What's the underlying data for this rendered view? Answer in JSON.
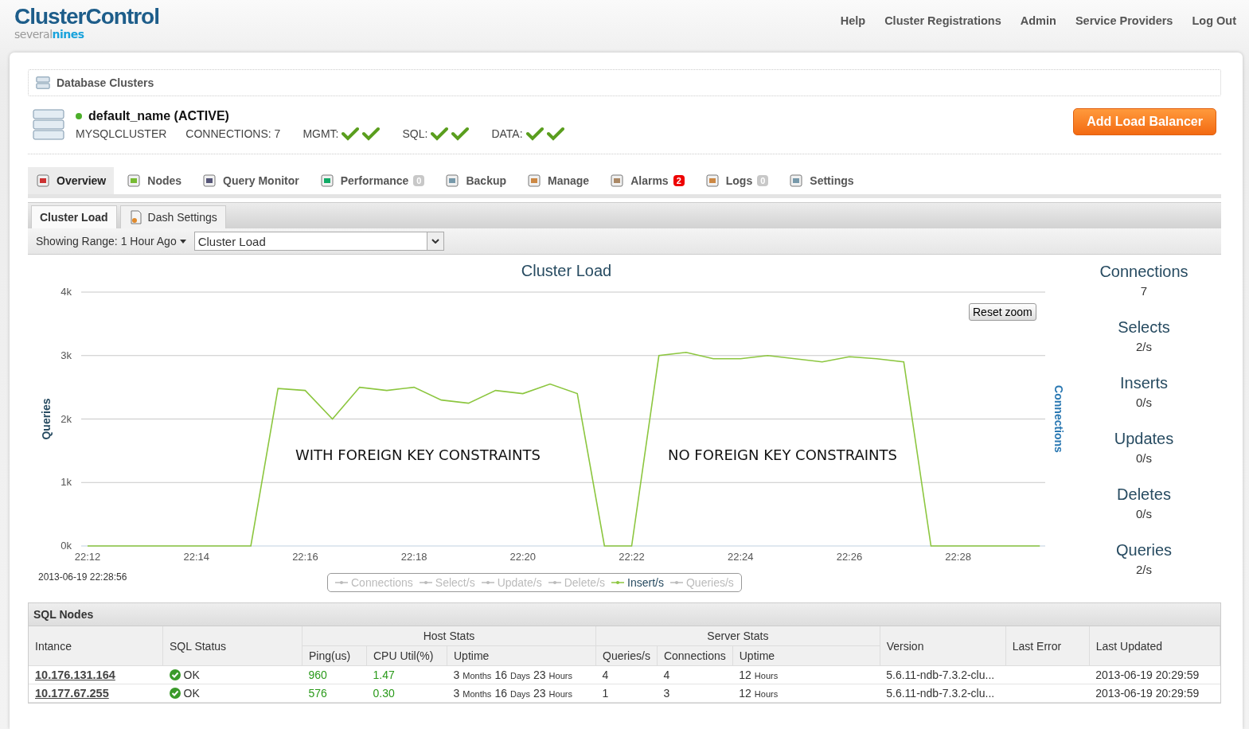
{
  "header": {
    "logo_main": "ClusterControl",
    "logo_sub_a": "several",
    "logo_sub_b": "nines",
    "nav": [
      "Help",
      "Cluster Registrations",
      "Admin",
      "Service Providers",
      "Log Out"
    ]
  },
  "breadcrumb": "Database Clusters",
  "cluster": {
    "name": "default_name (ACTIVE)",
    "active": true,
    "type": "MYSQLCLUSTER",
    "connections": "CONNECTIONS: 7",
    "groups": [
      {
        "label": "MGMT:",
        "checks": [
          {
            "ok": true
          },
          {
            "ok": true
          }
        ]
      },
      {
        "label": "SQL:",
        "checks": [
          {
            "ok": true
          },
          {
            "ok": true
          }
        ]
      },
      {
        "label": "DATA:",
        "checks": [
          {
            "ok": true
          },
          {
            "ok": true
          }
        ]
      }
    ],
    "action": "Add Load Balancer"
  },
  "tabs": [
    {
      "label": "Overview",
      "selected": true
    },
    {
      "label": "Nodes",
      "selected": false
    },
    {
      "label": "Query Monitor",
      "selected": false
    },
    {
      "label": "Performance",
      "selected": false,
      "badge": "0",
      "alert": false
    },
    {
      "label": "Backup",
      "selected": false
    },
    {
      "label": "Manage",
      "selected": false
    },
    {
      "label": "Alarms",
      "selected": false,
      "badge": "2",
      "alert": true
    },
    {
      "label": "Logs",
      "selected": false,
      "badge": "0",
      "alert": false
    },
    {
      "label": "Settings",
      "selected": false
    }
  ],
  "subtabs": [
    {
      "label": "Cluster Load",
      "selected": true
    },
    {
      "label": "Dash Settings",
      "selected": false
    }
  ],
  "range": {
    "label": "Showing Range: 1 Hour Ago",
    "select": "Cluster Load"
  },
  "chart": {
    "reset": "Reset zoom",
    "timestamp": "2013-06-19 22:28:56",
    "right_label": "Connections",
    "legend": [
      {
        "kind": "hidden",
        "label": "Connections"
      },
      {
        "kind": "hidden",
        "label": "Select/s"
      },
      {
        "kind": "hidden",
        "label": "Update/s"
      },
      {
        "kind": "hidden",
        "label": "Delete/s"
      },
      {
        "kind": "series"
      },
      {
        "kind": "hidden",
        "label": "Queries/s"
      }
    ],
    "chart_data": {
      "type": "line",
      "title": "Cluster Load",
      "ylabel": "Queries",
      "categories": [
        "22:12",
        null,
        null,
        null,
        "22:14",
        null,
        null,
        null,
        "22:16",
        null,
        null,
        null,
        "22:18",
        null,
        null,
        null,
        "22:20",
        null,
        null,
        null,
        "22:22",
        null,
        null,
        null,
        "22:24",
        null,
        null,
        null,
        "22:26",
        null,
        null,
        null,
        "22:28",
        null,
        null,
        null
      ],
      "series": [
        {
          "name": "Insert/s",
          "color": "#8cc63f",
          "values": [
            0,
            0,
            0,
            0,
            0,
            0,
            0,
            2480,
            2450,
            2000,
            2500,
            2450,
            2500,
            2300,
            2250,
            2450,
            2400,
            2550,
            2400,
            0,
            0,
            3000,
            3050,
            2950,
            2950,
            3000,
            2950,
            2900,
            2980,
            2950,
            2900,
            0,
            0,
            0,
            0,
            0
          ]
        }
      ],
      "ylim": [
        0,
        4000
      ],
      "grid": true,
      "yticks": [
        {
          "value": 0,
          "label": "0k"
        },
        {
          "value": 1000,
          "label": "1k"
        },
        {
          "value": 2000,
          "label": "2k"
        },
        {
          "value": 3000,
          "label": "3k"
        },
        {
          "value": 4000,
          "label": "4k"
        }
      ],
      "annotations": [
        "WITH FOREIGN KEY CONSTRAINTS",
        "NO FOREIGN KEY CONSTRAINTS"
      ]
    }
  },
  "stats": [
    {
      "label": "Connections",
      "value": "7"
    },
    {
      "label": "Selects",
      "value": "2/s"
    },
    {
      "label": "Inserts",
      "value": "0/s"
    },
    {
      "label": "Updates",
      "value": "0/s"
    },
    {
      "label": "Deletes",
      "value": "0/s"
    },
    {
      "label": "Queries",
      "value": "2/s"
    }
  ],
  "sql_nodes": {
    "title": "SQL Nodes",
    "group_host": "Host Stats",
    "group_server": "Server Stats",
    "columns": [
      "Intance",
      "SQL Status",
      "Ping(us)",
      "CPU Util(%)",
      "Uptime",
      "Queries/s",
      "Connections",
      "Uptime",
      "Version",
      "Last Error",
      "Last Updated"
    ],
    "rows": [
      {
        "instance": "10.176.131.164",
        "status": "OK",
        "ok": true,
        "ping": "960",
        "cpu": "1.47",
        "host_uptime": "3 Months 16 Days 23 Hours",
        "queries": "4",
        "connections": "4",
        "server_uptime": "12 Hours",
        "version": "5.6.11-ndb-7.3.2-clu...",
        "updated": "2013-06-19 20:29:59"
      },
      {
        "instance": "10.177.67.255",
        "status": "OK",
        "ok": true,
        "ping": "576",
        "cpu": "0.30",
        "host_uptime": "3 Months 16 Days 23 Hours",
        "queries": "1",
        "connections": "3",
        "server_uptime": "12 Hours",
        "version": "5.6.11-ndb-7.3.2-clu...",
        "updated": "2013-06-19 20:29:59"
      }
    ]
  }
}
